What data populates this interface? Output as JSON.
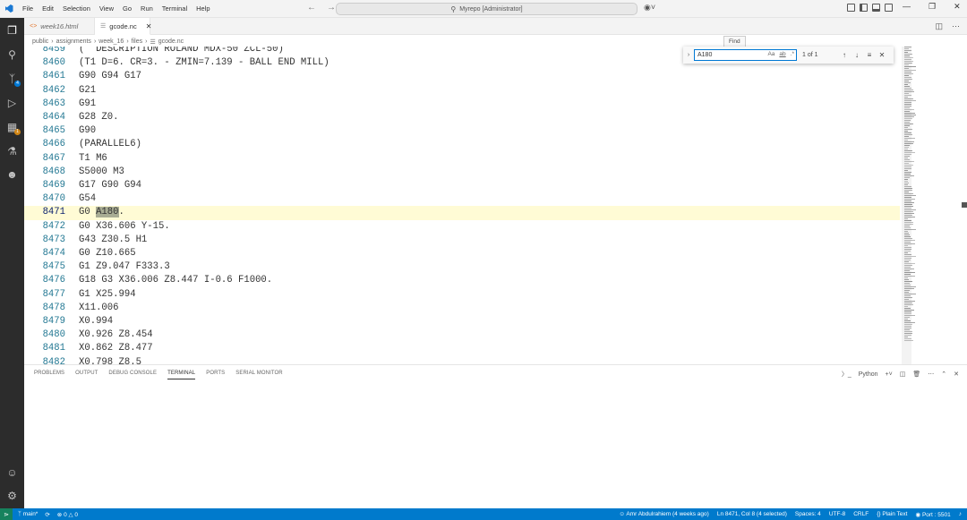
{
  "titlebar": {
    "menus": [
      "File",
      "Edit",
      "Selection",
      "View",
      "Go",
      "Run",
      "Terminal",
      "Help"
    ],
    "command_center": "Myrepo [Administrator]"
  },
  "tabs": [
    {
      "label": "week16.html",
      "icon": "html-file-icon",
      "active": false
    },
    {
      "label": "gcode.nc",
      "icon": "file-icon",
      "active": true
    }
  ],
  "breadcrumb": [
    "public",
    "assignments",
    "week_16",
    "files",
    "gcode.nc"
  ],
  "editor": {
    "lines": [
      {
        "num": "8459",
        "code": "(  DESCRIPTION ROLAND MDX-50 ZCL-50)"
      },
      {
        "num": "8460",
        "code": "(T1 D=6. CR=3. - ZMIN=7.139 - BALL END MILL)"
      },
      {
        "num": "8461",
        "code": "G90 G94 G17"
      },
      {
        "num": "8462",
        "code": "G21"
      },
      {
        "num": "8463",
        "code": "G91"
      },
      {
        "num": "8464",
        "code": "G28 Z0."
      },
      {
        "num": "8465",
        "code": "G90"
      },
      {
        "num": "8466",
        "code": "(PARALLEL6)"
      },
      {
        "num": "8467",
        "code": "T1 M6"
      },
      {
        "num": "8468",
        "code": "S5000 M3"
      },
      {
        "num": "8469",
        "code": "G17 G90 G94"
      },
      {
        "num": "8470",
        "code": "G54"
      },
      {
        "num": "8471",
        "code": "G0 A180.",
        "current": true,
        "pre": "G0 ",
        "match": "A180",
        "post": "."
      },
      {
        "num": "8472",
        "code": "G0 X36.606 Y-15."
      },
      {
        "num": "8473",
        "code": "G43 Z30.5 H1"
      },
      {
        "num": "8474",
        "code": "G0 Z10.665"
      },
      {
        "num": "8475",
        "code": "G1 Z9.047 F333.3"
      },
      {
        "num": "8476",
        "code": "G18 G3 X36.006 Z8.447 I-0.6 F1000."
      },
      {
        "num": "8477",
        "code": "G1 X25.994"
      },
      {
        "num": "8478",
        "code": "X11.006"
      },
      {
        "num": "8479",
        "code": "X0.994"
      },
      {
        "num": "8480",
        "code": "X0.926 Z8.454"
      },
      {
        "num": "8481",
        "code": "X0.862 Z8.477"
      },
      {
        "num": "8482",
        "code": "X0.798 Z8.5"
      }
    ]
  },
  "find": {
    "tooltip": "Find",
    "value": "A180",
    "opt_case": "Aa",
    "opt_word": "ab",
    "opt_regex": ".*",
    "count": "1 of 1"
  },
  "panel": {
    "tabs": [
      "PROBLEMS",
      "OUTPUT",
      "DEBUG CONSOLE",
      "TERMINAL",
      "PORTS",
      "SERIAL MONITOR"
    ],
    "active_tab": "TERMINAL",
    "terminal_name": "Python"
  },
  "statusbar": {
    "branch": "main*",
    "errors": "0",
    "warnings": "0",
    "blame": "Amr Abdulrahiem (4 weeks ago)",
    "position": "Ln 8471, Col 8 (4 selected)",
    "spaces": "Spaces: 4",
    "encoding": "UTF-8",
    "eol": "CRLF",
    "language": "Plain Text",
    "port": "Port : 5501"
  },
  "colors": {
    "accent": "#007acc",
    "current_line": "#fffbd5",
    "line_number": "#237893",
    "find_match": "#a8ac94"
  }
}
